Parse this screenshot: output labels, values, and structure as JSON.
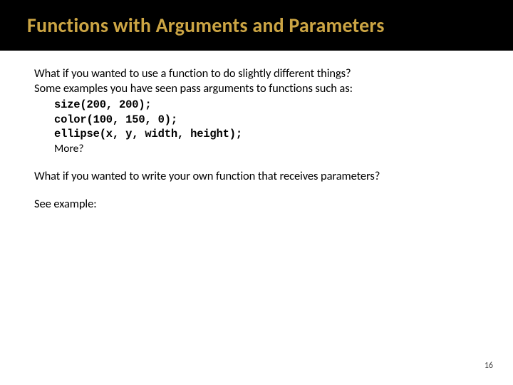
{
  "title": "Functions with Arguments and Parameters",
  "intro": {
    "line1": "What if you wanted to use a function to do slightly different  things?",
    "line2": "Some examples you have seen pass arguments to functions such as:"
  },
  "code": {
    "line1": "size(200, 200);",
    "line2": "color(100, 150, 0);",
    "line3": "ellipse(x, y, width, height);",
    "more": "More?"
  },
  "para1": "What if you wanted to write your own function that receives parameters?",
  "para2": "See example:",
  "page_number": "16"
}
